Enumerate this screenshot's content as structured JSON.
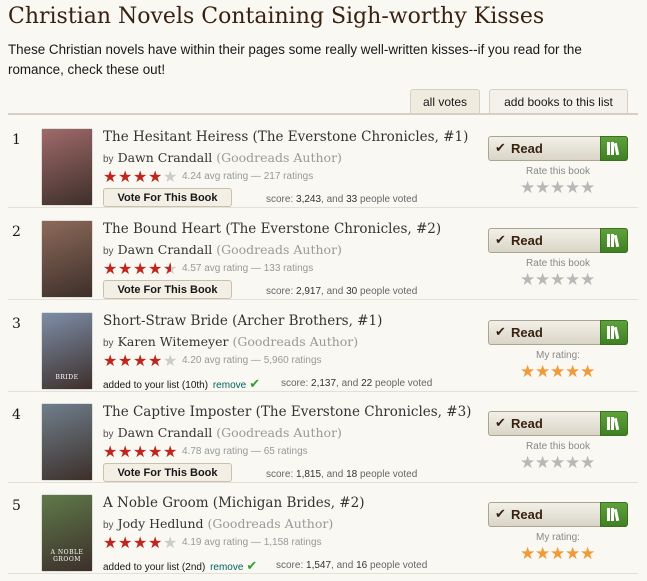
{
  "page": {
    "title": "Christian Novels Containing Sigh-worthy Kisses",
    "description": "These Christian novels have within their pages some really well-written kisses--if you read for the romance, check these out!"
  },
  "tabs": {
    "all_votes": "all votes",
    "add_books": "add books to this list"
  },
  "labels": {
    "by": "by",
    "vote_button": "Vote For This Book",
    "read_button": "Read",
    "rate_this_book": "Rate this book",
    "my_rating": "My rating:",
    "score_prefix": "score: ",
    "and": ", and ",
    "people_voted": " people voted",
    "remove": "remove"
  },
  "colors": {
    "star_red": "#c0251d",
    "star_orange": "#f19a38",
    "shelf_green": "#4f9131",
    "title_brown": "#382110"
  },
  "books": [
    {
      "rank": "1",
      "title": "The Hesitant Heiress (The Everstone Chronicles, #1)",
      "author": "Dawn Crandall",
      "author_note": "(Goodreads Author)",
      "avg_rating": 4.24,
      "rating_text": "4.24 avg rating — 217 ratings",
      "score": "3,243",
      "voters": "33",
      "added_text": "",
      "user_rating": 0,
      "cover_color": "#a06a6a",
      "cover_text": ""
    },
    {
      "rank": "2",
      "title": "The Bound Heart (The Everstone Chronicles, #2)",
      "author": "Dawn Crandall",
      "author_note": "(Goodreads Author)",
      "avg_rating": 4.57,
      "rating_text": "4.57 avg rating — 133 ratings",
      "score": "2,917",
      "voters": "30",
      "added_text": "",
      "user_rating": 0,
      "cover_color": "#8c6a5a",
      "cover_text": ""
    },
    {
      "rank": "3",
      "title": "Short-Straw Bride (Archer Brothers, #1)",
      "author": "Karen Witemeyer",
      "author_note": "(Goodreads Author)",
      "avg_rating": 4.2,
      "rating_text": "4.20 avg rating — 5,960 ratings",
      "score": "2,137",
      "voters": "22",
      "added_text": "added to your list (10th)",
      "user_rating": 5,
      "cover_color": "#7d8ea8",
      "cover_text": "BRIDE"
    },
    {
      "rank": "4",
      "title": "The Captive Imposter (The Everstone Chronicles, #3)",
      "author": "Dawn Crandall",
      "author_note": "(Goodreads Author)",
      "avg_rating": 4.78,
      "rating_text": "4.78 avg rating — 65 ratings",
      "score": "1,815",
      "voters": "18",
      "added_text": "",
      "user_rating": 0,
      "cover_color": "#6f7f8c",
      "cover_text": ""
    },
    {
      "rank": "5",
      "title": "A Noble Groom (Michigan Brides, #2)",
      "author": "Jody Hedlund",
      "author_note": "(Goodreads Author)",
      "avg_rating": 4.19,
      "rating_text": "4.19 avg rating — 1,158 ratings",
      "score": "1,547",
      "voters": "16",
      "added_text": "added to your list (2nd)",
      "user_rating": 5,
      "cover_color": "#5f7a4a",
      "cover_text": "A NOBLE GROOM"
    }
  ]
}
